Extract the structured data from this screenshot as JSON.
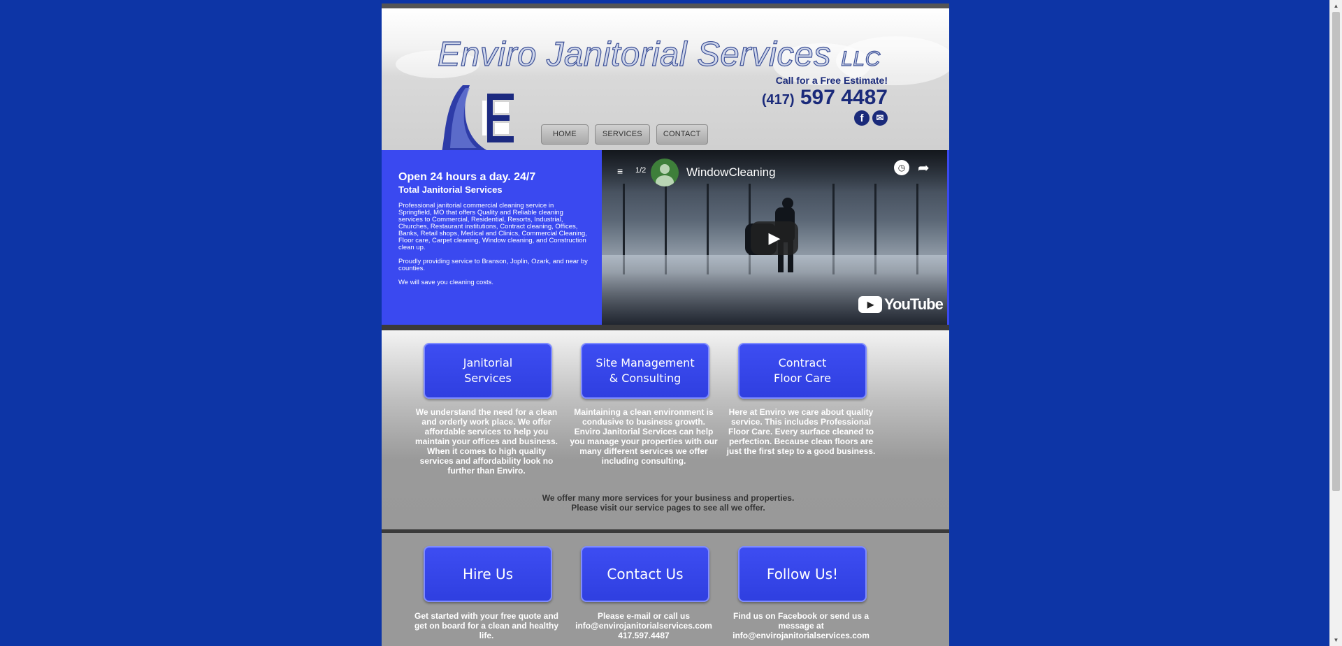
{
  "header": {
    "title": "Enviro Janitorial Services",
    "title_suffix": "LLC",
    "call_label": "Call for a Free Estimate!",
    "phone_area": "(417)",
    "phone_number": "597 4487",
    "social": [
      {
        "icon": "facebook-icon",
        "glyph": "f"
      },
      {
        "icon": "email-icon",
        "glyph": "✉"
      }
    ]
  },
  "nav": {
    "items": [
      "HOME",
      "SERVICES",
      "CONTACT"
    ]
  },
  "hero": {
    "heading": "Open 24 hours a day. 24/7",
    "subheading": "Total Janitorial Services",
    "paragraph1": "Professional janitorial commercial cleaning service in Springfield, MO that offers Quality and Reliable cleaning services to Commercial, Residential, Resorts, Industrial, Churches, Restaurant institutions, Contract cleaning, Offices, Banks, Retail shops, Medical and Clinics, Commercial Cleaning, Floor care, Carpet cleaning, Window cleaning, and Construction clean up.",
    "paragraph2": "Proudly providing service to Branson, Joplin, Ozark, and near by counties.",
    "paragraph3": "We will save you cleaning costs."
  },
  "video": {
    "playlist_count": "1/2",
    "title": "WindowCleaning",
    "brand": "YouTube"
  },
  "services": {
    "buttons": [
      {
        "line1": "Janitorial",
        "line2": "Services"
      },
      {
        "line1": "Site Management",
        "line2": "& Consulting"
      },
      {
        "line1": "Contract",
        "line2": "Floor Care"
      }
    ],
    "descriptions": [
      "We understand the need for a clean and orderly work place. We offer affordable services to help you maintain your offices and business. When it comes to high quality services and affordability look no further than Enviro.",
      "Maintaining a clean environment is condusive to business growth. Enviro Janitorial Services can help you manage your properties with our many different services we offer including consulting.",
      "Here at Enviro we care about quality service. This includes Professional Floor Care. Every surface cleaned to perfection. Because clean floors are just the first step to a good business."
    ],
    "more_line1": "We offer many more services for your business and properties.",
    "more_line2": "Please visit our service pages to see all we offer."
  },
  "actions": {
    "buttons": [
      "Hire Us",
      "Contact Us",
      "Follow Us!"
    ],
    "texts": [
      "Get started with your free quote and get on board for a clean and healthy life.",
      "Please e-mail or call us info@envirojanitorialservices.com 417.597.4487",
      "Find us on Facebook or send us a message at info@envirojanitorialservices.com"
    ]
  },
  "colors": {
    "page_background": "#0d35a6",
    "hero_blue": "#3a49f0",
    "button_blue": "#3d4df2",
    "phone_navy": "#1a2a7a"
  }
}
